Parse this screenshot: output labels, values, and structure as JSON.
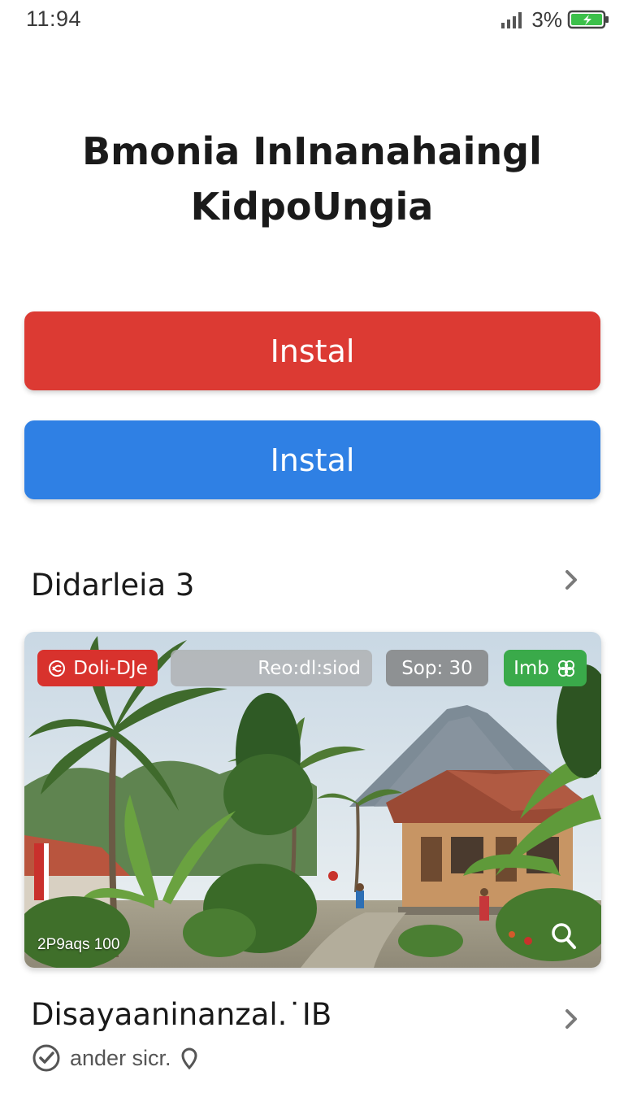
{
  "status_bar": {
    "time": "11:94",
    "battery": "3%"
  },
  "title": {
    "line1": "Bmonia InInanahaingl",
    "line2": "KidpoUngia"
  },
  "buttons": {
    "primary_label": "Instal",
    "secondary_label": "Instal"
  },
  "section": {
    "title": "Didarleia 3"
  },
  "card": {
    "chips": {
      "red": "Doli-DJe",
      "gray": "Reo:dl:siod",
      "dark": "Sop: 30",
      "green": "Imb"
    },
    "caption": "2P9aqs 100"
  },
  "item": {
    "title": "Disayaaninanzal.˙IB",
    "meta": "ander sicr."
  },
  "colors": {
    "red_button": "#dc3a33",
    "blue_button": "#2f80e4",
    "chip_green": "#3aaa4a",
    "chip_red": "#d8322d",
    "battery_green": "#3cc04a"
  },
  "icons": [
    "signal-icon",
    "battery-icon",
    "chevron-right-icon",
    "badge-icon",
    "clover-icon",
    "search-icon",
    "check-circle-icon",
    "location-pin-icon"
  ]
}
